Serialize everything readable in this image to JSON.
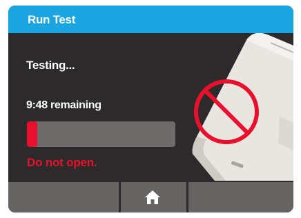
{
  "header": {
    "title": "Run Test"
  },
  "main": {
    "status": "Testing...",
    "remaining": "9:48 remaining",
    "progress_fraction": 0.07,
    "warning": "Do not open."
  },
  "icons": {
    "prohibited": "prohibited-icon",
    "home": "home-icon"
  },
  "colors": {
    "titlebar": "#1aa4e0",
    "background": "#2d2a2b",
    "progress_fill": "#e8112d",
    "progress_track": "#6e6c6a",
    "warning": "#e8112d",
    "nav_button": "#666462"
  }
}
